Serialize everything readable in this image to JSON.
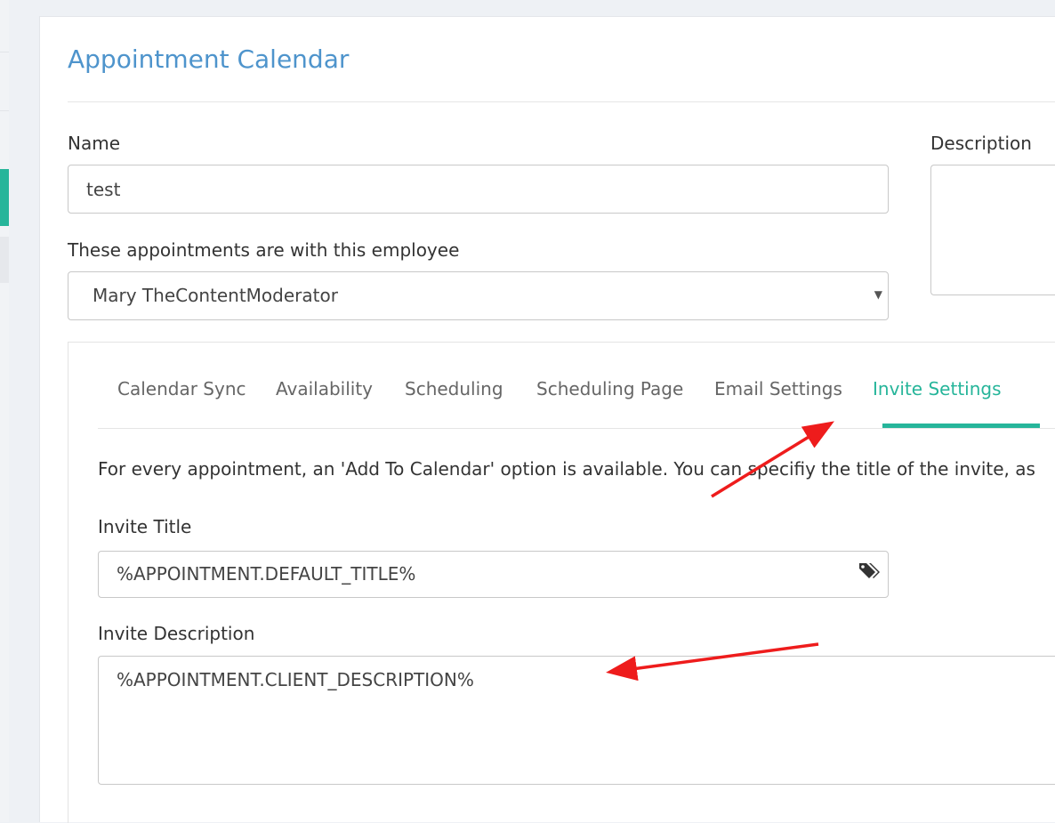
{
  "page": {
    "title": "Appointment Calendar"
  },
  "form": {
    "name_label": "Name",
    "name_value": "test",
    "description_label": "Description",
    "description_value": "",
    "employee_label": "These appointments are with this employee",
    "employee_selected": "Mary TheContentModerator"
  },
  "tabs": [
    {
      "label": "Calendar Sync",
      "active": false
    },
    {
      "label": "Availability",
      "active": false
    },
    {
      "label": "Scheduling",
      "active": false
    },
    {
      "label": "Scheduling Page",
      "active": false
    },
    {
      "label": "Email Settings",
      "active": false
    },
    {
      "label": "Invite Settings",
      "active": true
    }
  ],
  "invite": {
    "intro_text": "For every appointment, an 'Add To Calendar' option is available. You can specifiy the title of the invite, as",
    "title_label": "Invite Title",
    "title_value": "%APPOINTMENT.DEFAULT_TITLE%",
    "title_icon": "tags-icon",
    "description_label": "Invite Description",
    "description_value": "%APPOINTMENT.CLIENT_DESCRIPTION%"
  },
  "colors": {
    "accent": "#26b59a",
    "title": "#4e94cc",
    "annotation": "#ee1c1c"
  }
}
